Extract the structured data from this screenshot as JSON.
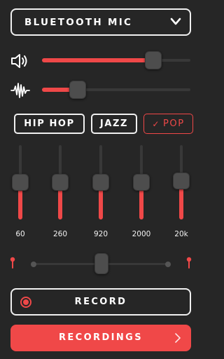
{
  "source": {
    "label": "BLUETOOTH MIC",
    "icon": "chevron-down-icon"
  },
  "volume": {
    "icon": "speaker-icon",
    "level": 0.75
  },
  "gain": {
    "icon": "waveform-icon",
    "level": 0.24
  },
  "presets": [
    {
      "label": "HIP HOP",
      "active": false
    },
    {
      "label": "JAZZ",
      "active": false
    },
    {
      "label": "POP",
      "active": true,
      "check": "✓"
    }
  ],
  "equalizer": {
    "bands": [
      {
        "freq": "60",
        "level": 0.5
      },
      {
        "freq": "260",
        "level": 0.5
      },
      {
        "freq": "920",
        "level": 0.5
      },
      {
        "freq": "2000",
        "level": 0.5
      },
      {
        "freq": "20k",
        "level": 0.53
      }
    ]
  },
  "balance": {
    "left_icon": "left-earbud-icon",
    "right_icon": "right-earbud-icon",
    "value": 0.5
  },
  "record": {
    "label": "RECORD",
    "icon": "record-icon"
  },
  "recordings": {
    "label": "RECORDINGS",
    "icon": "chevron-right-icon"
  },
  "colors": {
    "accent": "#ef4848",
    "background": "#262626",
    "knob": "#4d4d4d",
    "track": "#383838"
  }
}
